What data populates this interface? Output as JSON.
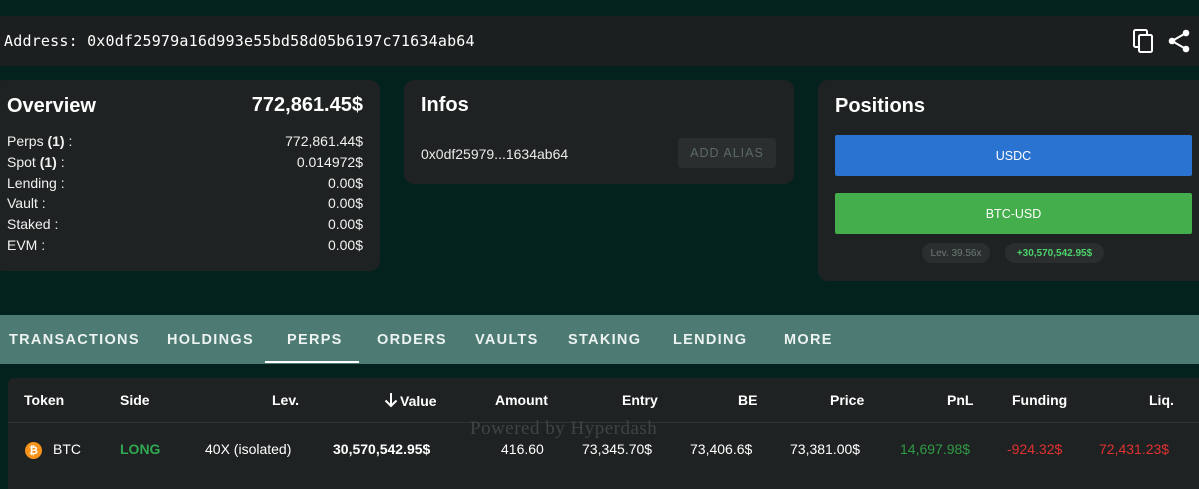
{
  "address_bar": {
    "label": "Address: 0x0df25979a16d993e55bd58d05b6197c71634ab64",
    "icons": [
      "copy-icon",
      "share-icon"
    ]
  },
  "overview": {
    "title": "Overview",
    "total": "772,861.45$",
    "rows": [
      {
        "label": "Perps ",
        "count": "(1)",
        "suffix": " :",
        "value": "772,861.44$"
      },
      {
        "label": "Spot ",
        "count": "(1)",
        "suffix": " :",
        "value": "0.014972$"
      },
      {
        "label": "Lending :",
        "count": "",
        "suffix": "",
        "value": "0.00$"
      },
      {
        "label": "Vault :",
        "count": "",
        "suffix": "",
        "value": "0.00$"
      },
      {
        "label": "Staked :",
        "count": "",
        "suffix": "",
        "value": "0.00$"
      },
      {
        "label": "EVM :",
        "count": "",
        "suffix": "",
        "value": "0.00$"
      }
    ]
  },
  "infos": {
    "title": "Infos",
    "short_address": "0x0df25979...1634ab64",
    "alias_button": "ADD ALIAS"
  },
  "positions": {
    "title": "Positions",
    "buttons": [
      "USDC",
      "BTC-USD"
    ],
    "leverage_pill": "Lev. 39.56x",
    "pnl_pill": "+30,570,542.95$",
    "colors": {
      "usdc": "#2b73d1",
      "btc": "#44ad4c"
    }
  },
  "tabs": {
    "items": [
      "TRANSACTIONS",
      "HOLDINGS",
      "PERPS",
      "ORDERS",
      "VAULTS",
      "STAKING",
      "LENDING",
      "MORE"
    ],
    "active": "PERPS"
  },
  "table": {
    "headers": [
      "Token",
      "Side",
      "Lev.",
      "Value",
      "Amount",
      "Entry",
      "BE",
      "Price",
      "PnL",
      "Funding",
      "Liq."
    ],
    "sort_icon": "arrow-down-icon",
    "watermark": "Powered by Hyperdash",
    "rows": [
      {
        "token": "BTC",
        "side": "LONG",
        "lev": "40X (isolated)",
        "value": "30,570,542.95$",
        "amount": "416.60",
        "entry": "73,345.70$",
        "be": "73,406.6$",
        "price": "73,381.00$",
        "pnl": "14,697.98$",
        "funding": "-924.32$",
        "liq": "72,431.23$"
      }
    ],
    "colors": {
      "long": "#2fa84f",
      "pnl": "#2f9a45",
      "funding": "#e03131",
      "liq": "#e03131"
    }
  }
}
